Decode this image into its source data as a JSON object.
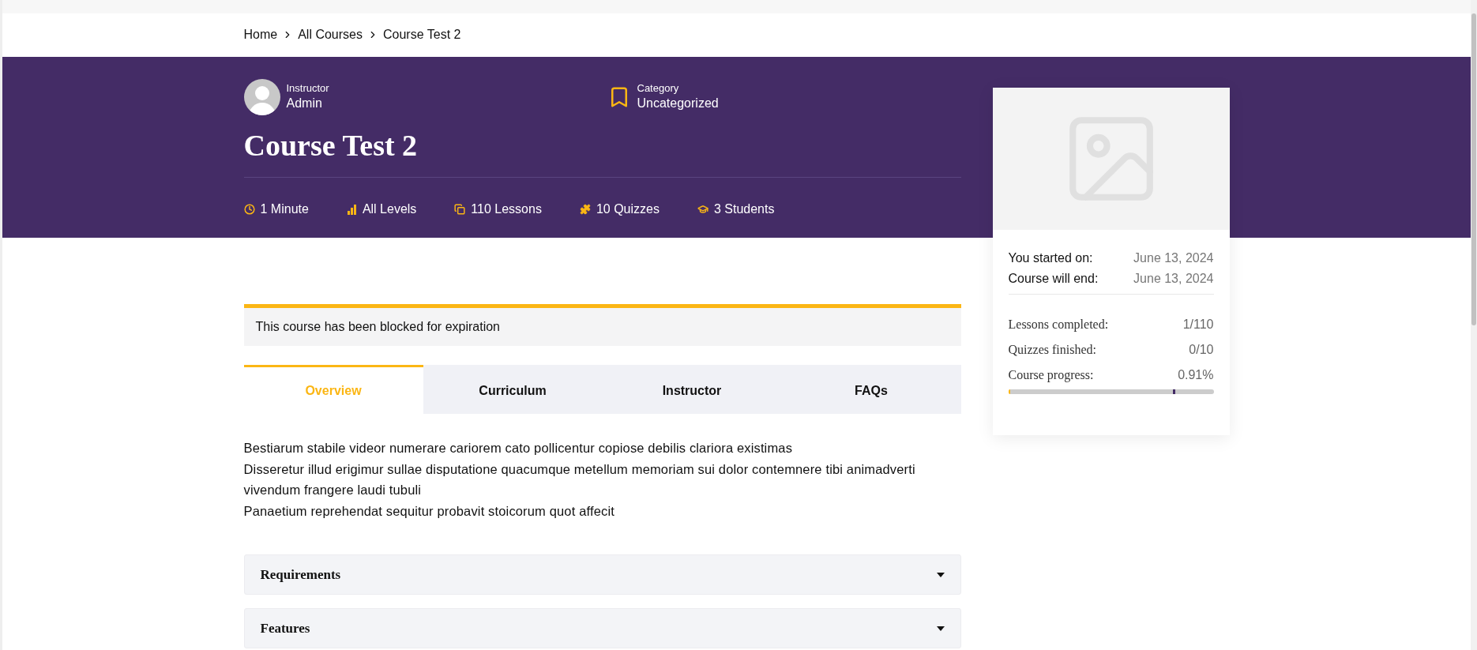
{
  "breadcrumb": [
    {
      "label": "Home"
    },
    {
      "label": "All Courses"
    },
    {
      "label": "Course Test 2"
    }
  ],
  "instructor": {
    "label": "Instructor",
    "name": "Admin"
  },
  "category": {
    "label": "Category",
    "name": "Uncategorized"
  },
  "title": "Course Test 2",
  "meta": [
    {
      "kind": "duration",
      "text": "1 Minute"
    },
    {
      "kind": "level",
      "text": "All Levels"
    },
    {
      "kind": "lessons",
      "text": "110 Lessons"
    },
    {
      "kind": "quizzes",
      "text": "10 Quizzes"
    },
    {
      "kind": "students",
      "text": "3 Students"
    }
  ],
  "notice": "This course has been blocked for expiration",
  "tabs": [
    {
      "label": "Overview",
      "selected": true
    },
    {
      "label": "Curriculum",
      "selected": false
    },
    {
      "label": "Instructor",
      "selected": false
    },
    {
      "label": "FAQs",
      "selected": false
    }
  ],
  "description": [
    "Bestiarum stabile videor numerare cariorem cato pollicentur copiose debilis clariora existimas",
    "Disseretur illud erigimur sullae disputatione quacumque metellum memoriam sui dolor contemnere tibi animadverti vivendum frangere laudi tubuli",
    "Panaetium reprehendat sequitur probavit stoicorum quot affecit"
  ],
  "accordions": [
    {
      "title": "Requirements",
      "expanded": false
    },
    {
      "title": "Features",
      "expanded": false
    }
  ],
  "card": {
    "dates": [
      {
        "label": "You started on:",
        "value": "June 13, 2024"
      },
      {
        "label": "Course will end:",
        "value": "June 13, 2024"
      }
    ],
    "stats": [
      {
        "label": "Lessons completed:",
        "value": "1/110"
      },
      {
        "label": "Quizzes finished:",
        "value": "0/10"
      }
    ],
    "progress": {
      "label": "Course progress:",
      "value": "0.91%",
      "level": 0.0091,
      "passing_grade": {
        "level": 0.8
      }
    }
  }
}
